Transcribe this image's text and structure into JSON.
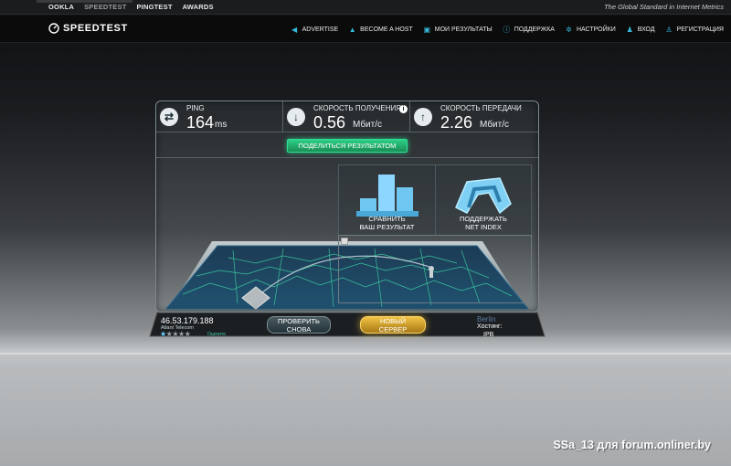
{
  "topbar": {
    "links": [
      "OOKLA",
      "SPEEDTEST",
      "PINGTEST",
      "AWARDS"
    ],
    "tagline": "The Global Standard in Internet Metrics"
  },
  "header": {
    "logo": "SPEEDTEST",
    "nav": [
      {
        "label": "ADVERTISE",
        "icon": "megaphone-icon"
      },
      {
        "label": "BECOME A HOST",
        "icon": "triangle-icon"
      },
      {
        "label": "МОИ РЕЗУЛЬТАТЫ",
        "icon": "camera-icon"
      },
      {
        "label": "ПОДДЕРЖКА",
        "icon": "info-icon"
      },
      {
        "label": "НАСТРОЙКИ",
        "icon": "gear-icon"
      },
      {
        "label": "ВХОД",
        "icon": "person-icon"
      },
      {
        "label": "РЕГИСТРАЦИЯ",
        "icon": "person-plus-icon"
      }
    ]
  },
  "stats": {
    "ping": {
      "label": "PING",
      "value": "164",
      "unit": "ms"
    },
    "download": {
      "label": "СКОРОСТЬ ПОЛУЧЕНИЯ",
      "value": "0.56",
      "unit": "Мбит/с"
    },
    "upload": {
      "label": "СКОРОСТЬ ПЕРЕДАЧИ",
      "value": "2.26",
      "unit": "Мбит/с"
    }
  },
  "share_button": "ПОДЕЛИТЬСЯ РЕЗУЛЬТАТОМ",
  "actions": {
    "compare": [
      "СРАВНИТЬ",
      "ВАШ РЕЗУЛЬТАТ"
    ],
    "pledge": [
      "ПОДДЕРЖАТЬ",
      "NET INDEX"
    ]
  },
  "bottom": {
    "ip": "46.53.179.188",
    "isp": "Atlant Telecom",
    "rate_label": "Оцените",
    "stars_filled": 1,
    "stars_total": 5,
    "retest": [
      "ПРОВЕРИТЬ",
      "СНОВА"
    ],
    "new_server": [
      "НОВЫЙ",
      "СЕРВЕР"
    ],
    "city": "Berlin",
    "host_label": "Хостинг:",
    "host_value": "IPB"
  },
  "watermark": "SSa_13 для forum.onliner.by",
  "colors": {
    "accent": "#36b8d8",
    "share": "#2ecf85",
    "new_server": "#f0c244"
  }
}
